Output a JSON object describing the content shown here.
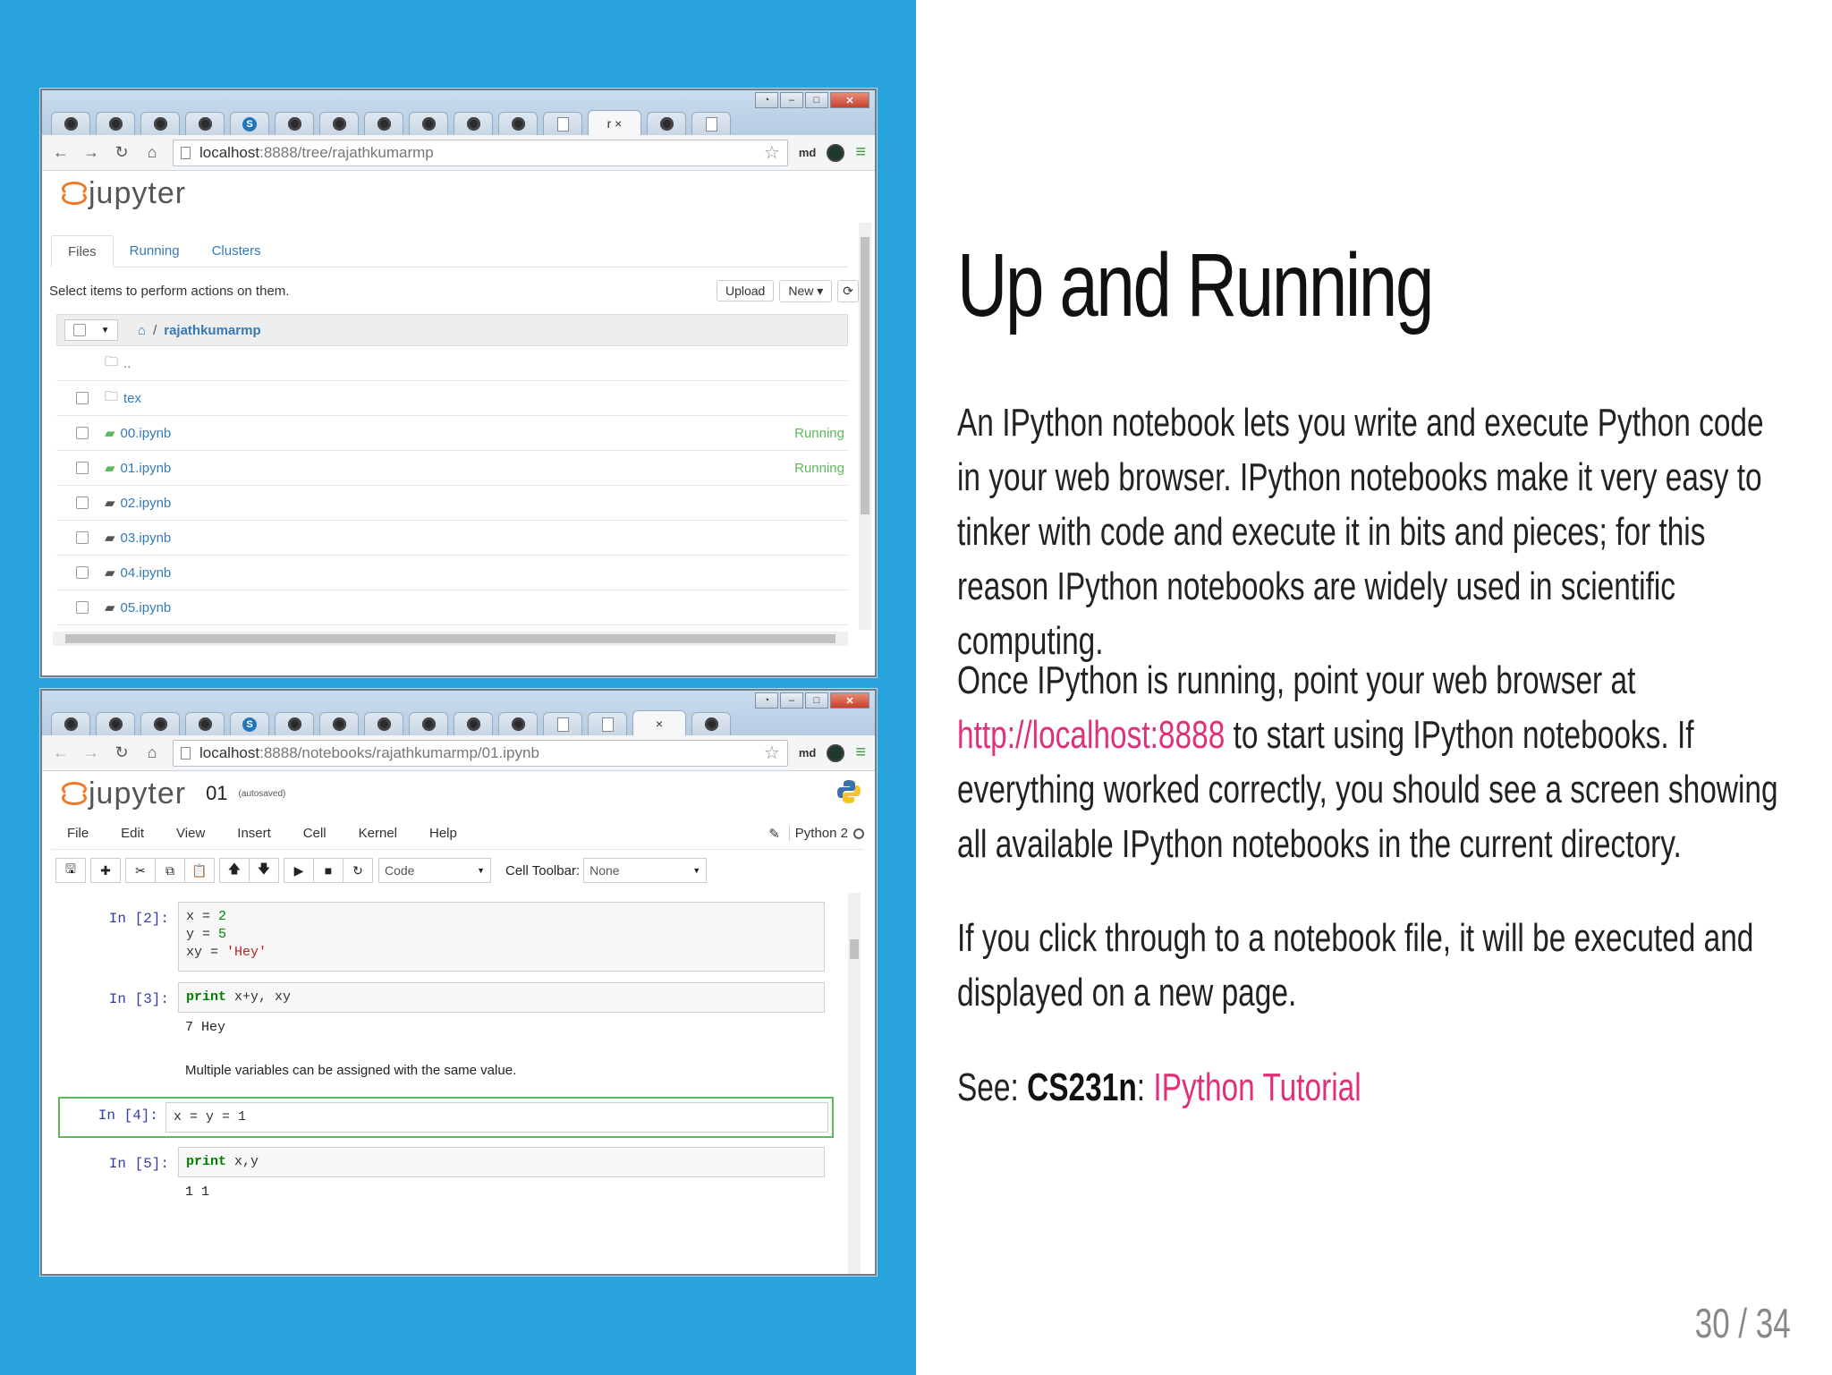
{
  "slide": {
    "title": "Up and Running",
    "paragraph1": "An IPython notebook lets you write and execute Python code in your web browser. IPython notebooks make it very easy to tinker with code and execute it in bits and pieces; for this reason IPython notebooks are widely used in scientific computing.",
    "paragraph2_before": "Once IPython is running, point your web browser at ",
    "paragraph2_link": "http://localhost:8888",
    "paragraph2_after": " to start using IPython notebooks. If everything worked correctly, you should see a screen showing all available IPython notebooks in the current directory.",
    "paragraph3": "If you click through to a notebook file, it will be executed and displayed on a new page.",
    "see_label": "See: ",
    "see_ref": "CS231n",
    "see_sep": ": ",
    "see_link": "IPython Tutorial",
    "page_number": "30 / 34",
    "colors": {
      "panel": "#29a3dc",
      "link": "#e0307a"
    }
  },
  "browser1": {
    "url_host": "localhost",
    "url_rest": ":8888/tree/rajathkumarmp",
    "ext_label": "md",
    "logo_text": "jupyter",
    "tabs": [
      "Files",
      "Running",
      "Clusters"
    ],
    "actions_text": "Select items to perform actions on them.",
    "upload_label": "Upload",
    "new_label": "New ▾",
    "refresh_icon": "⟳",
    "breadcrumb": "rajathkumarmp",
    "breadcrumb_sep": "/",
    "rows": [
      {
        "name": "..",
        "status": ""
      },
      {
        "name": "tex",
        "status": ""
      },
      {
        "name": "00.ipynb",
        "status": "Running"
      },
      {
        "name": "01.ipynb",
        "status": "Running"
      },
      {
        "name": "02.ipynb",
        "status": ""
      },
      {
        "name": "03.ipynb",
        "status": ""
      },
      {
        "name": "04.ipynb",
        "status": ""
      },
      {
        "name": "05.ipynb",
        "status": ""
      }
    ]
  },
  "browser2": {
    "url_host": "localhost",
    "url_rest": ":8888/notebooks/rajathkumarmp/01.ipynb",
    "ext_label": "md",
    "logo_text": "jupyter",
    "notebook_name": "01",
    "autosaved": "(autosaved)",
    "menus": [
      "File",
      "Edit",
      "View",
      "Insert",
      "Cell",
      "Kernel",
      "Help"
    ],
    "kernel_name": "Python 2",
    "cell_type": "Code",
    "cell_toolbar_label": "Cell Toolbar:",
    "cell_toolbar_value": "None",
    "cells": {
      "c2_prompt": "In [2]:",
      "c3_prompt": "In [3]:",
      "c3_output": "7 Hey",
      "markdown": "Multiple variables can be assigned with the same value.",
      "c4_prompt": "In [4]:",
      "c4_code": "x = y = 1",
      "c5_prompt": "In [5]:",
      "c5_output": "1 1"
    }
  }
}
